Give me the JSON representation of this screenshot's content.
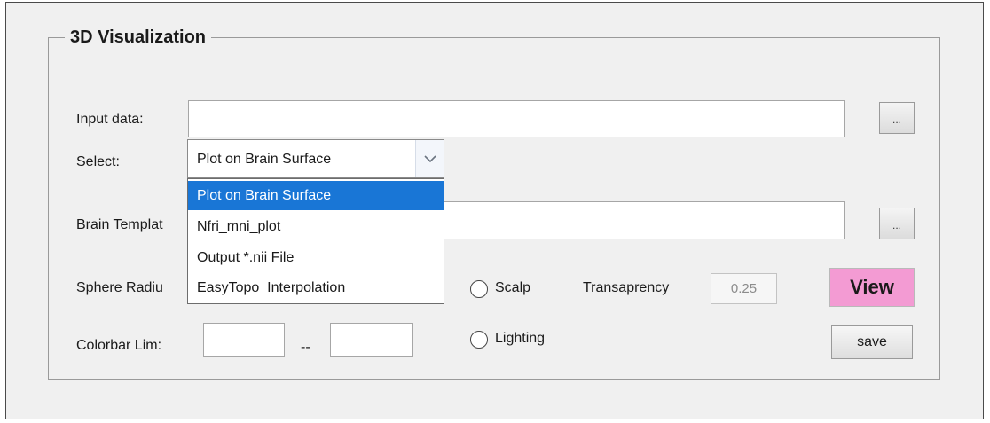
{
  "panel": {
    "title": "3D Visualization"
  },
  "input_data": {
    "label": "Input data:",
    "value": "",
    "browse_label": "..."
  },
  "select": {
    "label": "Select:",
    "value": "Plot on Brain Surface",
    "arrow_icon": "chevron-down-icon",
    "options": [
      "Plot on Brain Surface",
      "Nfri_mni_plot",
      "Output *.nii File",
      "EasyTopo_Interpolation"
    ],
    "selected_index": 0
  },
  "brain_template": {
    "label": "Brain Templat",
    "value": "",
    "browse_label": "..."
  },
  "sphere_radius": {
    "label": "Sphere Radiu"
  },
  "scalp": {
    "label": "Scalp",
    "checked": false
  },
  "transparency": {
    "label": "Transaprency",
    "value": "0.25"
  },
  "colorbar": {
    "label": "Colorbar Lim:",
    "min": "",
    "separator": "--",
    "max": ""
  },
  "lighting": {
    "label": "Lighting",
    "checked": false
  },
  "buttons": {
    "view": "View",
    "save": "save"
  },
  "colors": {
    "accent_selected": "#1976d6",
    "view_button": "#f39bd3"
  }
}
